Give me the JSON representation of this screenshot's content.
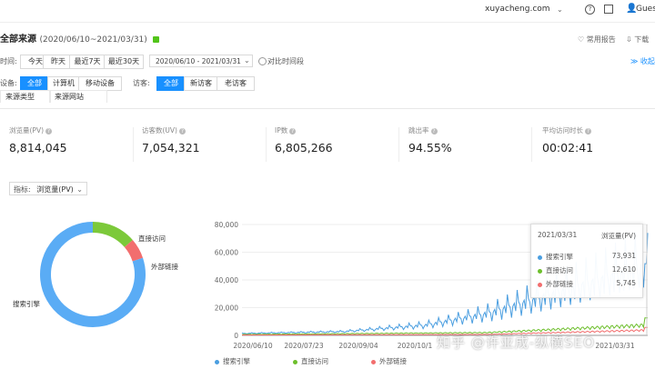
{
  "topbar": {
    "site": "xuyacheng.com",
    "user": "Gues",
    "icons": [
      "help-icon",
      "copy-icon",
      "user-icon"
    ]
  },
  "header": {
    "title": "全部来源",
    "date_range": "(2020/06/10~2021/03/31)",
    "links": [
      "常用报告",
      "下载"
    ],
    "collapse": "收起"
  },
  "filters": {
    "time_label": "时间:",
    "time_buttons": [
      "今天",
      "昨天",
      "最近7天",
      "最近30天"
    ],
    "date_value": "2020/06/10 - 2021/03/31",
    "compare_label": "对比时间段",
    "device_label": "设备:",
    "device_buttons": [
      "全部",
      "计算机",
      "移动设备"
    ],
    "visitor_label": "访客:",
    "visitor_buttons": [
      "全部",
      "新访客",
      "老访客"
    ]
  },
  "tabs": [
    "来源类型",
    "来源网站"
  ],
  "metrics": [
    {
      "label": "浏览量(PV)",
      "value": "8,814,045",
      "help": true
    },
    {
      "label": "访客数(UV)",
      "value": "7,054,321",
      "help": true
    },
    {
      "label": "IP数",
      "value": "6,805,266",
      "help": true
    },
    {
      "label": "跳出率",
      "value": "94.55%",
      "help": true
    },
    {
      "label": "平均访问时长",
      "value": "00:02:41",
      "help": true
    }
  ],
  "indicator": {
    "label": "指标:",
    "value": "浏览量(PV)"
  },
  "pie": {
    "slices": [
      {
        "name": "搜索引擎",
        "value": 73931,
        "color": "#5aacf5"
      },
      {
        "name": "直接访问",
        "value": 12610,
        "color": "#7cc93a"
      },
      {
        "name": "外部链接",
        "value": 5745,
        "color": "#f26e6e"
      }
    ]
  },
  "chart_data": {
    "type": "line",
    "x_ticks": [
      "2020/06/10",
      "2020/07/23",
      "2020/09/04",
      "2020/10/1",
      "2021/03/31"
    ],
    "y_ticks": [
      "0",
      "20,000",
      "40,000",
      "60,000",
      "80,000"
    ],
    "ylim": [
      0,
      80000
    ],
    "series": [
      {
        "name": "搜索引擎",
        "color": "#4a9ee0"
      },
      {
        "name": "直接访问",
        "color": "#6dbf2c"
      },
      {
        "name": "外部链接",
        "color": "#f26e6e"
      }
    ]
  },
  "tooltip": {
    "date": "2021/03/31",
    "metric": "浏览量(PV)",
    "rows": [
      {
        "name": "搜索引擎",
        "value": "73,931"
      },
      {
        "name": "直接访问",
        "value": "12,610"
      },
      {
        "name": "外部链接",
        "value": "5,745"
      }
    ]
  },
  "watermark": "知乎 @许亚成-纵横SEO"
}
